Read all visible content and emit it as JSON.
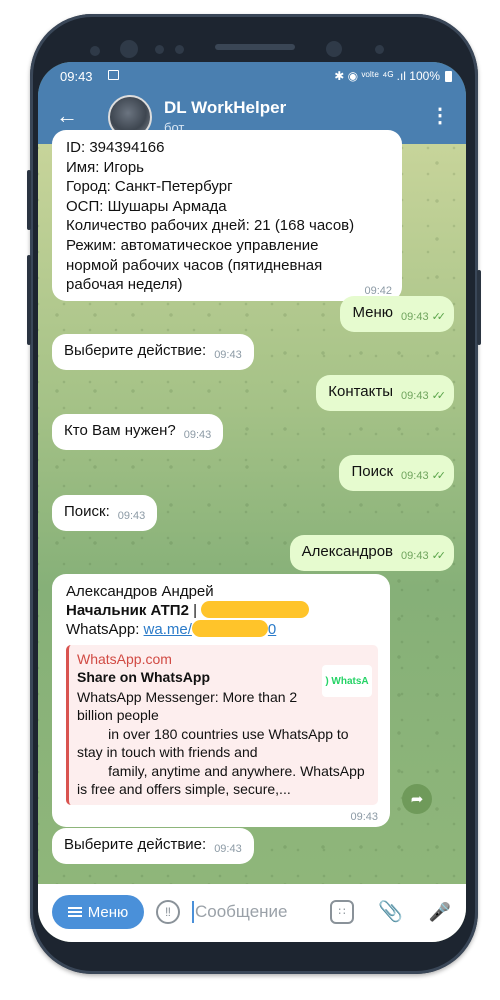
{
  "status_bar": {
    "time": "09:43",
    "right": "✱ ◉ ᵛᵒˡᵗᵉ ⁴ᴳ .ıl 100%"
  },
  "header": {
    "back_icon": "back-arrow-icon",
    "title": "DL WorkHelper",
    "subtitle": "бот",
    "more_icon": "more-vertical-icon"
  },
  "messages": {
    "info": {
      "lines": [
        "ID: 394394166",
        "Имя: Игорь",
        "Город: Санкт-Петербург",
        "ОСП: Шушары Армада",
        "Количество рабочих дней: 21 (168 часов)",
        "Режим: автоматическое управление",
        "нормой рабочих часов (пятидневная",
        "рабочая неделя)"
      ],
      "time": "09:42"
    },
    "m1": {
      "text": "Меню",
      "time": "09:43"
    },
    "m2": {
      "text": "Выберите действие:",
      "time": "09:43"
    },
    "m3": {
      "text": "Контакты",
      "time": "09:43"
    },
    "m4": {
      "text": "Кто Вам нужен?",
      "time": "09:43"
    },
    "m5": {
      "text": "Поиск",
      "time": "09:43"
    },
    "m6": {
      "text": "Поиск:",
      "time": "09:43"
    },
    "m7": {
      "text": "Александров",
      "time": "09:43"
    },
    "contact": {
      "name": "Александров Андрей",
      "position": "Начальник АТП2",
      "separator": " | ",
      "whatsapp_label": "WhatsApp: ",
      "whatsapp_link": "wa.me/",
      "link_tail": "0",
      "preview": {
        "site": "WhatsApp.com",
        "title": "Share on WhatsApp",
        "description": "WhatsApp Messenger: More than 2\nbillion people\n        in over 180 countries use WhatsApp to\nstay in touch with friends and\n        family, anytime and anywhere. WhatsApp\nis free and offers simple, secure,...",
        "thumb_text": ") WhatsA"
      },
      "time": "09:43"
    },
    "m8": {
      "text": "Выберите действие:",
      "time": "09:43"
    }
  },
  "input_bar": {
    "menu_label": "Меню",
    "placeholder": "Сообщение"
  },
  "colors": {
    "header": "#4a7fb0",
    "outgoing": "#e6fbcf",
    "incoming": "#ffffff",
    "menu_button": "#4a90d9",
    "redaction": "#ffc42a"
  }
}
